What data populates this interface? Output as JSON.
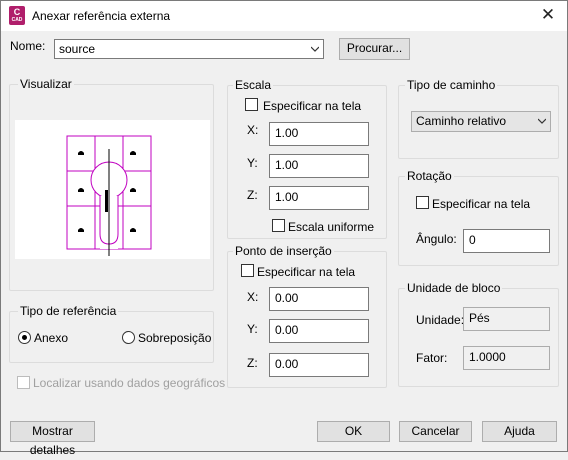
{
  "window": {
    "title": "Anexar referência externa",
    "app_icon_letter": "C",
    "app_icon_sub": "CAD",
    "close_glyph": "✕"
  },
  "name": {
    "label": "Nome:",
    "value": "source",
    "browse_label": "Procurar..."
  },
  "preview": {
    "label": "Visualizar"
  },
  "reference_type": {
    "label": "Tipo de referência",
    "options": [
      "Anexo",
      "Sobreposição"
    ],
    "selected": "Anexo"
  },
  "geo": {
    "label": "Localizar usando dados geográficos",
    "checked": false
  },
  "scale": {
    "label": "Escala",
    "specify_label": "Especificar na tela",
    "x_label": "X:",
    "x": "1.00",
    "y_label": "Y:",
    "y": "1.00",
    "z_label": "Z:",
    "z": "1.00",
    "uniform_label": "Escala uniforme"
  },
  "insertion": {
    "label": "Ponto de inserção",
    "specify_label": "Especificar na tela",
    "x_label": "X:",
    "x": "0.00",
    "y_label": "Y:",
    "y": "0.00",
    "z_label": "Z:",
    "z": "0.00"
  },
  "path_type": {
    "label": "Tipo de caminho",
    "value": "Caminho relativo"
  },
  "rotation": {
    "label": "Rotação",
    "specify_label": "Especificar na tela",
    "angle_label": "Ângulo:",
    "angle": "0"
  },
  "block_unit": {
    "label": "Unidade de bloco",
    "unit_label": "Unidade:",
    "unit": "Pés",
    "factor_label": "Fator:",
    "factor": "1.0000"
  },
  "buttons": {
    "details": "Mostrar detalhes",
    "ok": "OK",
    "cancel": "Cancelar",
    "help": "Ajuda"
  },
  "colors": {
    "drawing": "#c000c0",
    "app_icon": "#b01e6b"
  },
  "icons": {
    "combo_arrow": "chevron-down-icon",
    "close": "close-icon"
  }
}
